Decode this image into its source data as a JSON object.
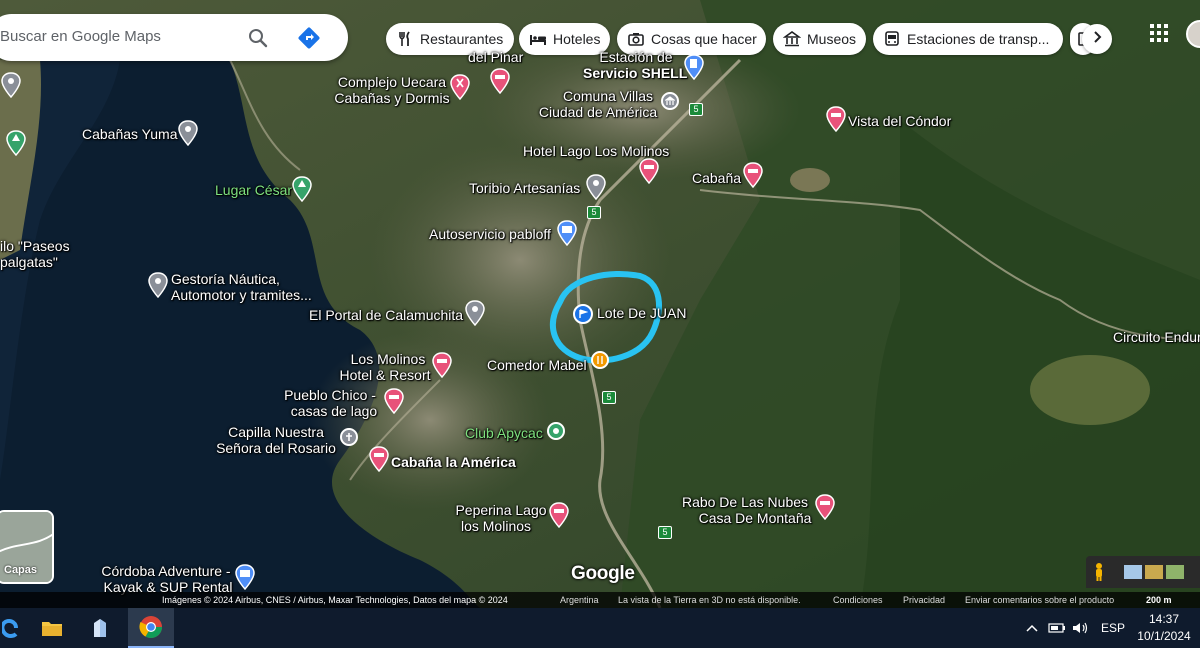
{
  "search": {
    "placeholder": "Buscar en Google Maps"
  },
  "chips": [
    {
      "label": "Restaurantes",
      "icon": "fork-knife-icon"
    },
    {
      "label": "Hoteles",
      "icon": "bed-icon"
    },
    {
      "label": "Cosas que hacer",
      "icon": "camera-icon"
    },
    {
      "label": "Museos",
      "icon": "museum-icon"
    },
    {
      "label": "Estaciones de transp...",
      "icon": "bus-icon"
    }
  ],
  "map_labels": {
    "del_pinar": "del Pinar",
    "estacion": "Estación de",
    "servicio_shell": "Servicio SHELL",
    "complejo_1": "Complejo Uecara",
    "complejo_2": "Cabañas y Dormis",
    "comuna_1": "Comuna Villas",
    "comuna_2": "Ciudad de América",
    "vista_condor": "Vista del Cóndor",
    "cabanas_yuma": "Cabañas Yuma",
    "hotel_lago": "Hotel Lago Los Molinos",
    "cabana": "Cabaña",
    "lugar_cesar": "Lugar César",
    "toribio": "Toribio Artesanías",
    "autoservicio": "Autoservicio pabloff",
    "paseos_1": "ilo \"Paseos",
    "paseos_2": "palgatas\"",
    "gestoria_1": "Gestoría Náutica,",
    "gestoria_2": "Automotor y tramites...",
    "lote": "Lote De JUAN",
    "portal": "El Portal de Calamuchita",
    "circuito": "Circuito Endur",
    "molinos_hotel_1": "Los Molinos",
    "molinos_hotel_2": "Hotel & Resort",
    "comedor": "Comedor Mabel",
    "pueblo_1": "Pueblo Chico -",
    "pueblo_2": "casas de lago",
    "capilla_1": "Capilla Nuestra",
    "capilla_2": "Señora del Rosario",
    "club": "Club Apycac",
    "cabana_america": "Cabaña la América",
    "rabo_1": "Rabo De Las Nubes",
    "rabo_2": "Casa De Montaña",
    "peperina_1": "Peperina Lago",
    "peperina_2": "los Molinos",
    "cordoba_1": "Córdoba Adventure -",
    "cordoba_2": "Kayak & SUP Rental",
    "google": "Google"
  },
  "route_numbers": [
    "5",
    "5",
    "5",
    "5",
    "5"
  ],
  "layers_label": "Capas",
  "attribution": {
    "imagery": "Imágenes © 2024 Airbus, CNES / Airbus, Maxar Technologies, Datos del mapa © 2024",
    "country": "Argentina",
    "notice": "La vista de la Tierra en 3D no está disponible.",
    "terms": "Condiciones",
    "privacy": "Privacidad",
    "feedback": "Enviar comentarios sobre el producto",
    "scale": "200 m"
  },
  "taskbar": {
    "language": "ESP",
    "time": "14:37",
    "date": "10/1/2024"
  },
  "colors": {
    "highlight_circle": "#29c3f2",
    "hotel_pin": "#e8527a",
    "landmark_pin": "#8a8f98",
    "shopping_pin": "#4f8ef7",
    "park_pin": "#35a36a"
  }
}
